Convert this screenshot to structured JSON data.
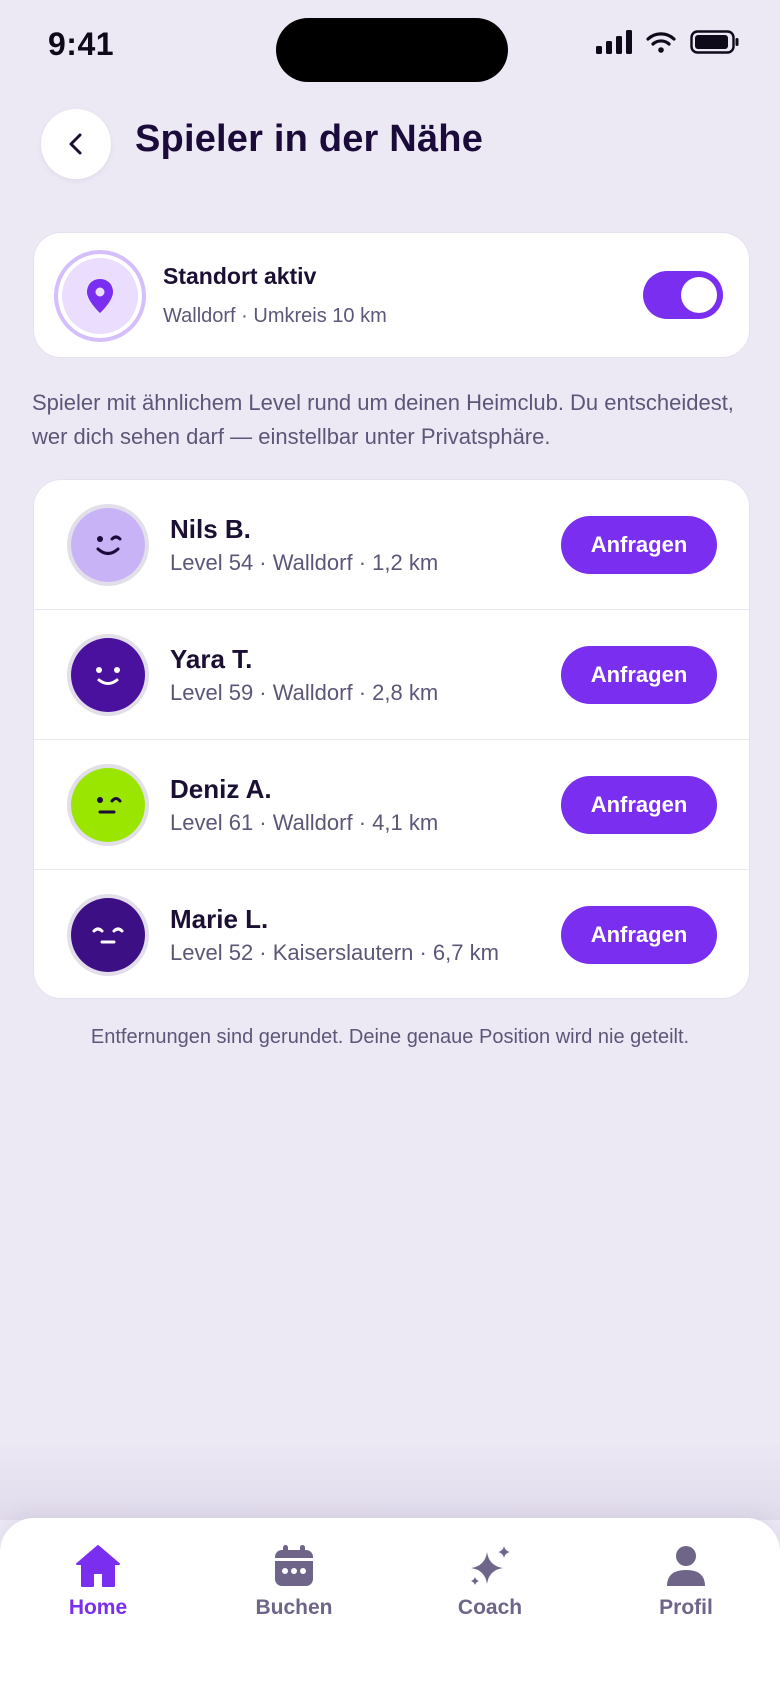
{
  "status_bar": {
    "time": "9:41"
  },
  "header": {
    "title": "Spieler in der Nähe"
  },
  "location": {
    "title": "Standort aktiv",
    "subtitle": "Walldorf · Umkreis 10 km",
    "toggle_on": true
  },
  "intro": "Spieler mit ähnlichem Level rund um deinen Heimclub. Du entscheidest, wer dich sehen darf — einstellbar unter Privatsphäre.",
  "players": [
    {
      "name": "Nils B.",
      "meta": "Level 54 · Walldorf · 1,2 km",
      "button": "Anfragen",
      "avatar_color": "#C9B3F7"
    },
    {
      "name": "Yara T.",
      "meta": "Level 59 · Walldorf · 2,8 km",
      "button": "Anfragen",
      "avatar_color": "#4A119E"
    },
    {
      "name": "Deniz A.",
      "meta": "Level 61 · Walldorf · 4,1 km",
      "button": "Anfragen",
      "avatar_color": "#9BE600"
    },
    {
      "name": "Marie L.",
      "meta": "Level 52 · Kaiserslautern · 6,7 km",
      "button": "Anfragen",
      "avatar_color": "#3D0F85"
    }
  ],
  "footnote": "Entfernungen sind gerundet. Deine genaue Position wird nie geteilt.",
  "nav": {
    "items": [
      {
        "label": "Home",
        "icon": "home-icon",
        "active": true
      },
      {
        "label": "Buchen",
        "icon": "calendar-icon",
        "active": false
      },
      {
        "label": "Coach",
        "icon": "sparkle-icon",
        "active": false
      },
      {
        "label": "Profil",
        "icon": "person-icon",
        "active": false
      }
    ]
  },
  "colors": {
    "accent": "#7A2EF0",
    "background": "#ECE8F4",
    "text": "#1B1033",
    "muted": "#5E5678"
  }
}
